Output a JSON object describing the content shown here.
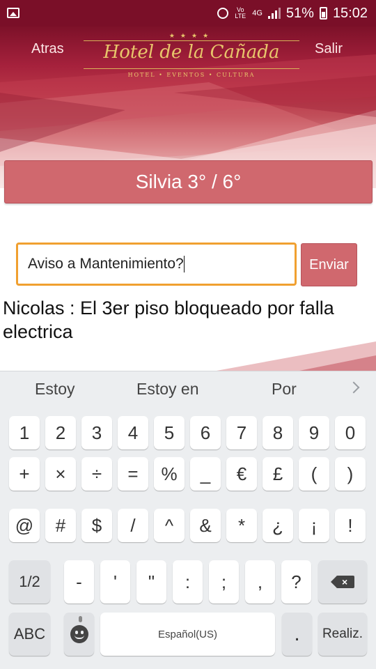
{
  "status_bar": {
    "network_small": "Vo LTE",
    "network_gen": "4G",
    "battery": "51%",
    "time": "15:02"
  },
  "header": {
    "back_label": "Atras",
    "exit_label": "Salir",
    "logo_title": "Hotel de la Cañada",
    "logo_subtitle": "HOTEL • EVENTOS • CULTURA",
    "logo_stars": "★★★★"
  },
  "room_button_label": "Silvia 3° / 6°",
  "message_input_value": "Aviso a Mantenimiento?",
  "send_label": "Enviar",
  "message_line": "Nicolas : El 3er piso bloqueado por falla electrica",
  "keyboard": {
    "suggestions": [
      "Estoy",
      "Estoy en",
      "Por"
    ],
    "row1": [
      "1",
      "2",
      "3",
      "4",
      "5",
      "6",
      "7",
      "8",
      "9",
      "0"
    ],
    "row2": [
      "+",
      "×",
      "÷",
      "=",
      "%",
      "_",
      "€",
      "£",
      "(",
      ")"
    ],
    "row3": [
      "@",
      "#",
      "$",
      "/",
      "^",
      "&",
      "*",
      "¿",
      "¡",
      "!"
    ],
    "row4": [
      "1/2",
      "-",
      "'",
      "\"",
      ":",
      ";",
      ",",
      "?"
    ],
    "abc_label": "ABC",
    "space_label": "Español(US)",
    "period_label": ".",
    "enter_label": "Realiz."
  },
  "colors": {
    "header_dark": "#7a0f28",
    "button": "#d0686e",
    "input_focus": "#f0a030",
    "logo_gold": "#e8c66b"
  }
}
